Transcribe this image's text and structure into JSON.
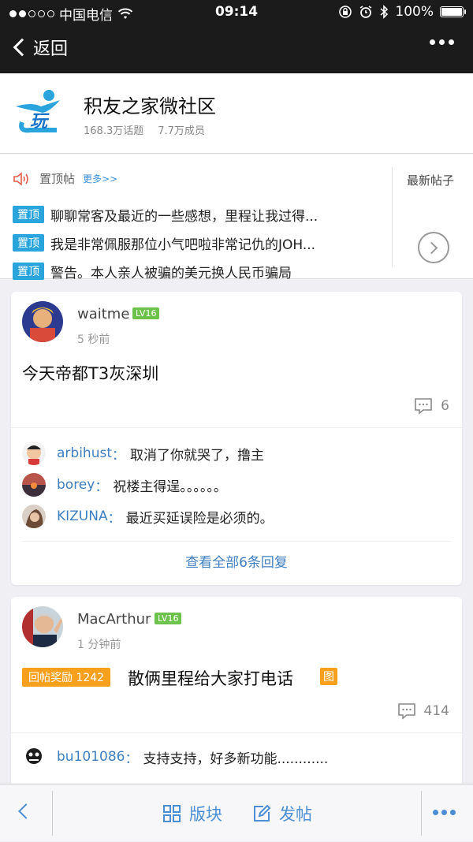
{
  "status_bar": {
    "carrier": "中国电信",
    "time": "09:14",
    "battery": "100%",
    "signal_bars": 2
  },
  "nav": {
    "back_label": "返回",
    "more_icon": "more-dots-icon"
  },
  "community": {
    "name": "积友之家微社区",
    "topics": "168.3万话题",
    "members": "7.7万成员"
  },
  "pinned": {
    "title": "置顶帖",
    "more": "更多>>",
    "latest_label": "最新帖子",
    "items": [
      {
        "tag": "置顶",
        "text": "聊聊常客及最近的一些感想，里程让我过得..."
      },
      {
        "tag": "置顶",
        "text": "我是非常佩服那位小气吧啦非常记仇的JOH..."
      },
      {
        "tag": "置顶",
        "text": "警告。本人亲人被骗的美元换人民币骗局"
      }
    ]
  },
  "posts": [
    {
      "username": "waitme",
      "level": "LV16",
      "time": "5 秒前",
      "title": "今天帝都T3灰深圳",
      "comment_count": "6",
      "replies": [
        {
          "user": "arbihust",
          "sep": "：",
          "text": "取消了你就哭了，撸主"
        },
        {
          "user": "borey",
          "sep": "：",
          "text": "祝楼主得逞。。。。。。"
        },
        {
          "user": "KIZUNA",
          "sep": "：",
          "text": "最近买延误险是必须的。"
        }
      ],
      "view_all": "查看全部6条回复"
    },
    {
      "username": "MacArthur",
      "level": "LV16",
      "time": "1 分钟前",
      "reward_tag": "回帖奖励 1242",
      "title": "散俩里程给大家打电话",
      "image_tag": "图",
      "comment_count": "414",
      "replies": [
        {
          "user": "bu101086",
          "sep": "：",
          "text": "支持支持，好多新功能............"
        }
      ]
    }
  ],
  "toolbar": {
    "board_label": "版块",
    "post_label": "发帖"
  },
  "colors": {
    "accent": "#4b8ed3",
    "link": "#3f7fc0",
    "pin_tag": "#2aa4dc",
    "level_badge": "#6cc24a",
    "reward": "#f6a01e",
    "bar_dark": "#1b1b1b"
  }
}
